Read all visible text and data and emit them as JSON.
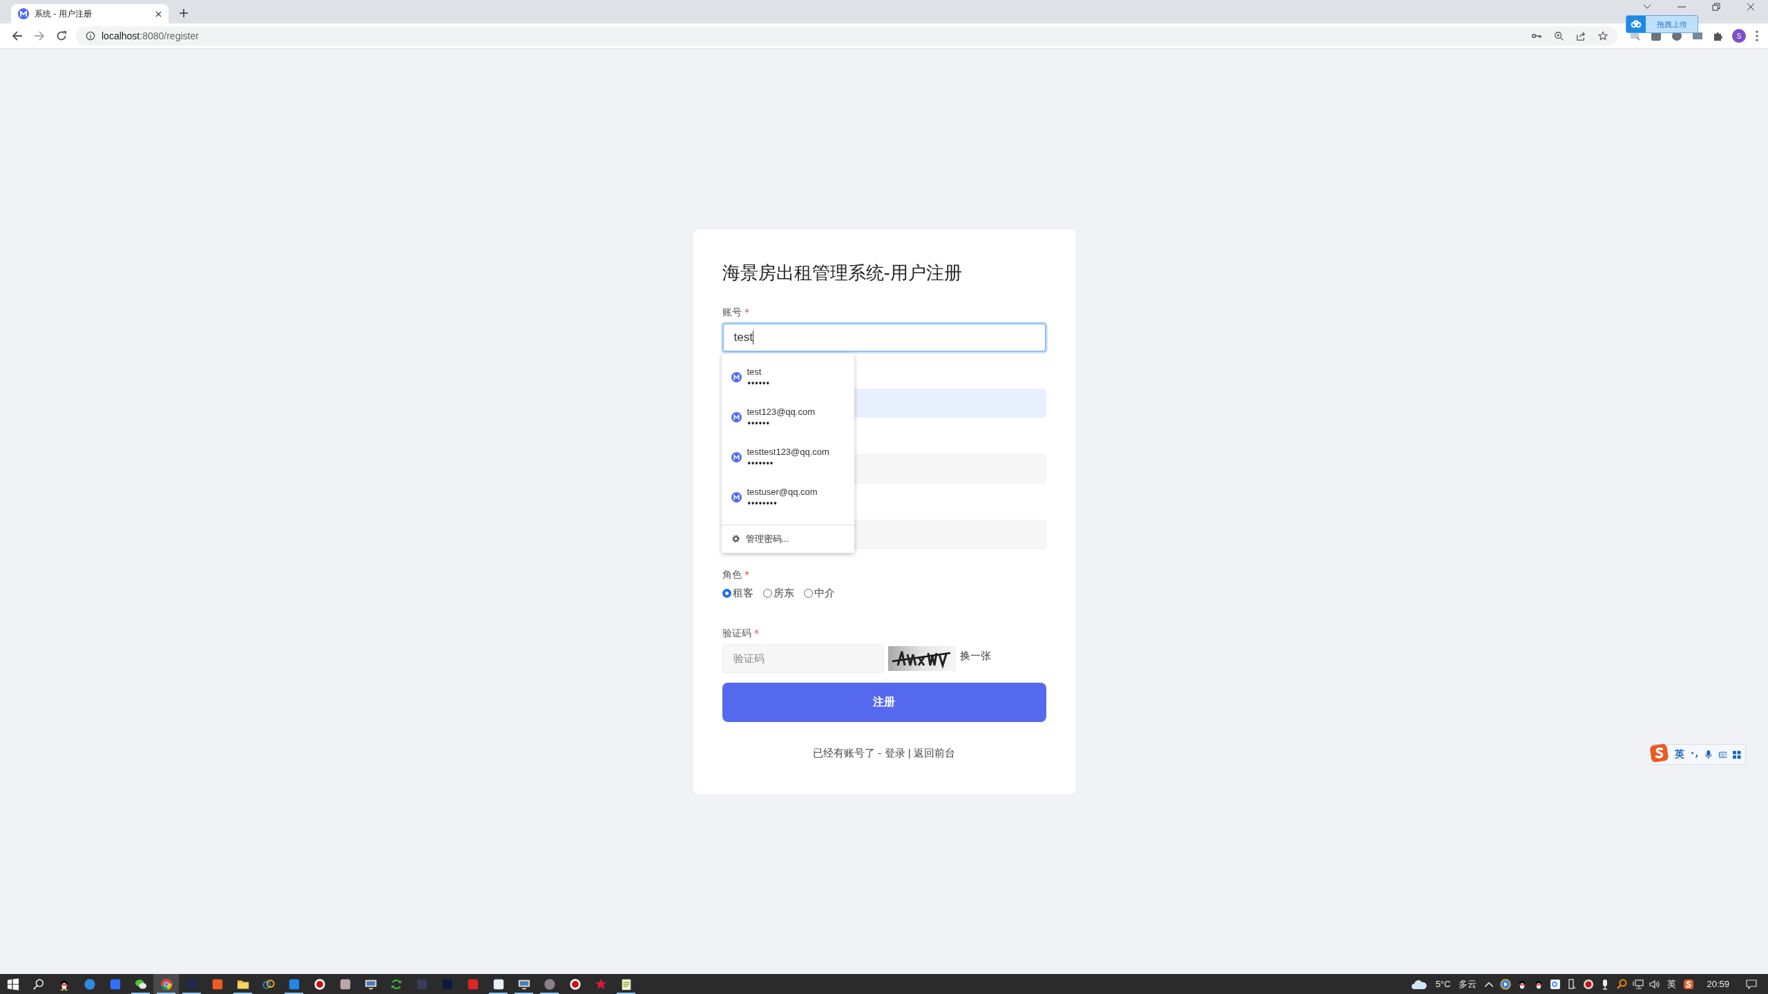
{
  "browser": {
    "tab": {
      "title": "系统 - 用户注册"
    },
    "address": {
      "host": "localhost",
      "rest": ":8080/register"
    },
    "upload_popup": "拖拽上传",
    "profile_initial": "S"
  },
  "form": {
    "title": "海景房出租管理系统-用户注册",
    "account": {
      "label": "账号",
      "required_mark": "*",
      "value": "test",
      "focused": true
    },
    "covered_inputs": [
      {
        "autofilled": true
      },
      {
        "autofilled": false
      },
      {
        "autofilled": false
      }
    ],
    "role": {
      "label": "角色",
      "required_mark": "*",
      "options": [
        {
          "label": "租客",
          "selected": true
        },
        {
          "label": "房东",
          "selected": false
        },
        {
          "label": "中介",
          "selected": false
        }
      ]
    },
    "captcha": {
      "label": "验证码",
      "required_mark": "*",
      "placeholder": "验证码",
      "refresh": "换一张"
    },
    "submit": "注册",
    "footer": {
      "text": "已经有账号了 - ",
      "login": "登录",
      "separator": " | ",
      "home": "返回前台"
    }
  },
  "autofill": {
    "suggestions": [
      {
        "username": "test",
        "password_mask": "••••••"
      },
      {
        "username": "test123@qq.com",
        "password_mask": "••••••"
      },
      {
        "username": "testtest123@qq.com",
        "password_mask": "•••••••"
      },
      {
        "username": "testuser@qq.com",
        "password_mask": "••••••••"
      }
    ],
    "manage": "管理密码..."
  },
  "ime_bar": {
    "mode": "英"
  },
  "taskbar": {
    "apps": [
      {
        "running": false,
        "selected": false
      },
      {
        "running": false,
        "selected": false
      },
      {
        "running": false,
        "selected": false
      },
      {
        "running": false,
        "selected": false
      },
      {
        "running": false,
        "selected": false
      },
      {
        "running": true,
        "selected": false
      },
      {
        "running": true,
        "selected": true
      },
      {
        "running": true,
        "selected": false
      },
      {
        "running": false,
        "selected": false
      },
      {
        "running": true,
        "selected": false
      },
      {
        "running": false,
        "selected": false
      },
      {
        "running": true,
        "selected": false
      },
      {
        "running": false,
        "selected": false
      },
      {
        "running": false,
        "selected": false
      },
      {
        "running": false,
        "selected": false
      },
      {
        "running": false,
        "selected": false
      },
      {
        "running": false,
        "selected": false
      },
      {
        "running": false,
        "selected": false
      },
      {
        "running": false,
        "selected": false
      },
      {
        "running": true,
        "selected": false
      },
      {
        "running": true,
        "selected": false
      },
      {
        "running": true,
        "selected": false
      },
      {
        "running": false,
        "selected": false
      },
      {
        "running": false,
        "selected": false
      },
      {
        "running": true,
        "selected": false
      }
    ],
    "weather": {
      "temperature": "5°C",
      "condition": "多云"
    },
    "input_mode": "英",
    "time": "20:59"
  }
}
